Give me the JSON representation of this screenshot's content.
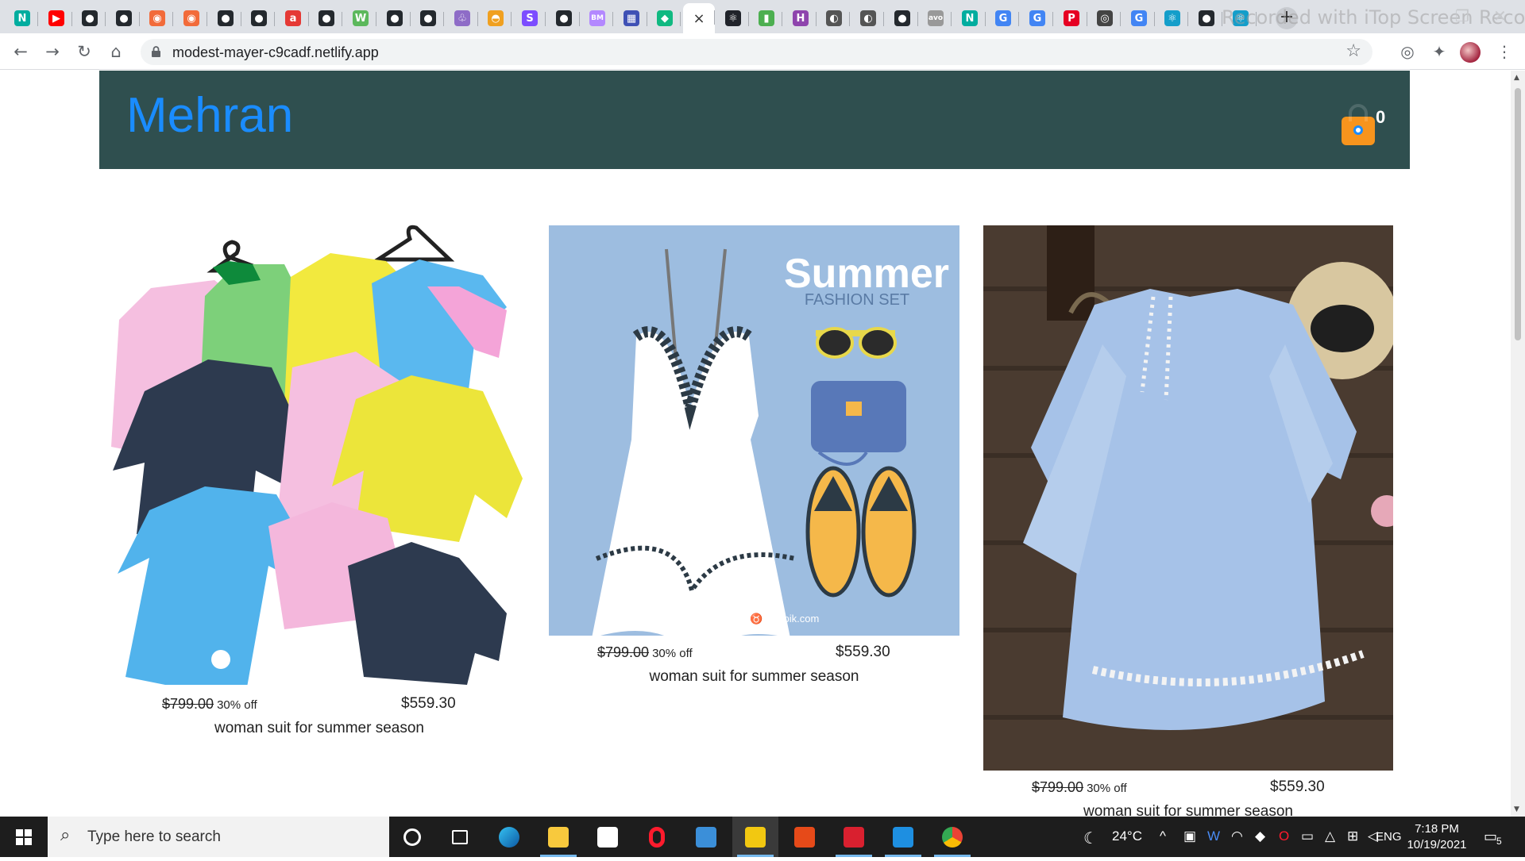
{
  "browser": {
    "tabs": [
      {
        "icon": "netlify-icon",
        "glyph": "N",
        "color": "#00ad9f"
      },
      {
        "icon": "youtube-icon",
        "glyph": "▶",
        "color": "#ff0000"
      },
      {
        "icon": "github-icon",
        "glyph": "●",
        "color": "#24292e"
      },
      {
        "icon": "github-icon",
        "glyph": "●",
        "color": "#24292e"
      },
      {
        "icon": "app-icon",
        "glyph": "◉",
        "color": "#f26b3a"
      },
      {
        "icon": "app-icon",
        "glyph": "◉",
        "color": "#f26b3a"
      },
      {
        "icon": "github-icon",
        "glyph": "●",
        "color": "#24292e"
      },
      {
        "icon": "github-icon",
        "glyph": "●",
        "color": "#24292e"
      },
      {
        "icon": "app-icon",
        "glyph": "a",
        "color": "#e53935"
      },
      {
        "icon": "github-icon",
        "glyph": "●",
        "color": "#24292e"
      },
      {
        "icon": "app-icon",
        "glyph": "W",
        "color": "#5cb85c"
      },
      {
        "icon": "github-icon",
        "glyph": "●",
        "color": "#24292e"
      },
      {
        "icon": "github-icon",
        "glyph": "●",
        "color": "#24292e"
      },
      {
        "icon": "app-icon",
        "glyph": "♧",
        "color": "#8e6cc7"
      },
      {
        "icon": "app-icon",
        "glyph": "◓",
        "color": "#f0a020"
      },
      {
        "icon": "app-icon",
        "glyph": "S",
        "color": "#7c4dff"
      },
      {
        "icon": "github-icon",
        "glyph": "●",
        "color": "#24292e"
      },
      {
        "icon": "app-icon",
        "glyph": "BM",
        "color": "#b388ff"
      },
      {
        "icon": "app-icon",
        "glyph": "▦",
        "color": "#3f51b5"
      },
      {
        "icon": "app-icon",
        "glyph": "◆",
        "color": "#10b981"
      },
      {
        "icon": "close-icon",
        "glyph": "×",
        "color": "#ffffff",
        "active": true
      },
      {
        "icon": "react-icon",
        "glyph": "⚛",
        "color": "#20232a"
      },
      {
        "icon": "mongodb-icon",
        "glyph": "▮",
        "color": "#4caf50"
      },
      {
        "icon": "app-icon",
        "glyph": "H",
        "color": "#8e44ad"
      },
      {
        "icon": "globe-icon",
        "glyph": "◐",
        "color": "#555555"
      },
      {
        "icon": "globe-icon",
        "glyph": "◐",
        "color": "#555555"
      },
      {
        "icon": "github-icon",
        "glyph": "●",
        "color": "#24292e"
      },
      {
        "icon": "app-icon",
        "glyph": "avo",
        "color": "#999999"
      },
      {
        "icon": "netlify-icon",
        "glyph": "N",
        "color": "#00ad9f"
      },
      {
        "icon": "google-icon",
        "glyph": "G",
        "color": "#4285f4"
      },
      {
        "icon": "google-icon",
        "glyph": "G",
        "color": "#4285f4"
      },
      {
        "icon": "pinterest-icon",
        "glyph": "P",
        "color": "#e60023"
      },
      {
        "icon": "app-icon",
        "glyph": "◎",
        "color": "#444444"
      },
      {
        "icon": "google-icon",
        "glyph": "G",
        "color": "#4285f4"
      },
      {
        "icon": "react-icon",
        "glyph": "⚛",
        "color": "#149eca"
      },
      {
        "icon": "github-icon",
        "glyph": "●",
        "color": "#24292e"
      },
      {
        "icon": "react-icon",
        "glyph": "⚛",
        "color": "#149eca"
      }
    ],
    "new_tab": "+",
    "watermark": "Recorded with iTop Screen Recorder",
    "url": "modest-mayer-c9cadf.netlify.app"
  },
  "site": {
    "brand": "Mehran",
    "cart_count": "0",
    "colors": {
      "header": "#2f4f4f",
      "brand": "#1a8cff",
      "cart": "#f7941d"
    }
  },
  "products": [
    {
      "image": "kids-clothes-illustration",
      "old_price": "$799.00",
      "discount": "30% off",
      "new_price": "$559.30",
      "title": "woman suit for summer season"
    },
    {
      "image": "summer-fashion-set",
      "image_title": "Summer",
      "image_subtitle": "FASHION SET",
      "image_credit": "designed by ♉ freepik.com",
      "old_price": "$799.00",
      "discount": "30% off",
      "new_price": "$559.30",
      "title": "woman suit for summer season"
    },
    {
      "image": "blue-blouse-photo",
      "old_price": "$799.00",
      "discount": "30% off",
      "new_price": "$559.30",
      "title": "woman suit for summer season"
    }
  ],
  "taskbar": {
    "search_placeholder": "Type here to search",
    "weather": "24°C",
    "language": "ENG",
    "time": "7:18 PM",
    "date": "10/19/2021",
    "notifications": "5"
  }
}
